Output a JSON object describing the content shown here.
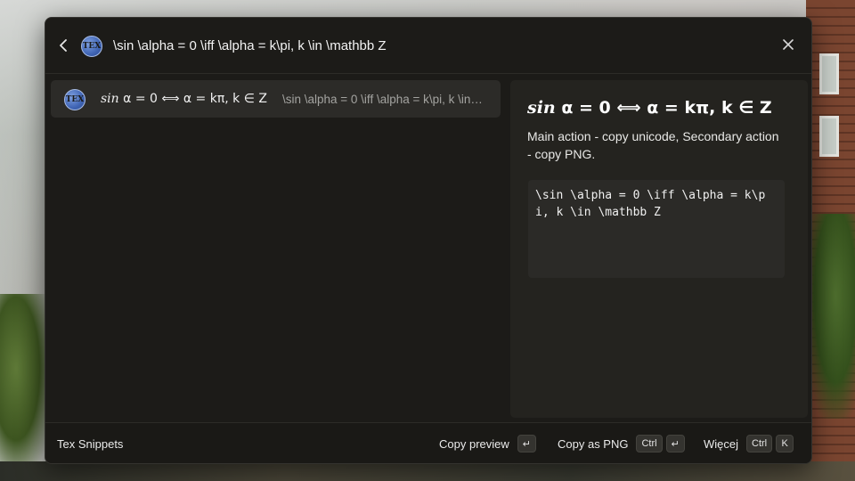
{
  "search": {
    "query": "\\sin \\alpha = 0 \\iff \\alpha = k\\pi, k \\in \\mathbb Z"
  },
  "extension_icon": {
    "name": "tex-logo-icon",
    "text": "TEX"
  },
  "result": {
    "title_italic": "sin",
    "title_rest": " α = 0 ⟺ α = kπ, k ∈ Z",
    "subtitle": "\\sin \\alpha = 0 \\iff \\alpha = k\\pi, k \\in \\mathbb Z"
  },
  "preview": {
    "title_italic": "sin",
    "title_rest": " α = 0 ⟺ α = kπ, k ∈ Z",
    "description": "Main action - copy unicode, Secondary action - copy PNG.",
    "code": "\\sin \\alpha = 0 \\iff \\alpha = k\\pi, k \\in \\mathbb Z"
  },
  "footer": {
    "title": "Tex Snippets",
    "actions": [
      {
        "label": "Copy preview",
        "keys": [
          "↵"
        ]
      },
      {
        "label": "Copy as PNG",
        "keys": [
          "Ctrl",
          "↵"
        ]
      },
      {
        "label": "Więcej",
        "keys": [
          "Ctrl",
          "K"
        ]
      }
    ]
  },
  "colors": {
    "window_bg": "#1c1b18",
    "selected_item_bg": "#2c2b28",
    "preview_bg": "#24231f",
    "spellcheck_underline": "#e0453c"
  }
}
